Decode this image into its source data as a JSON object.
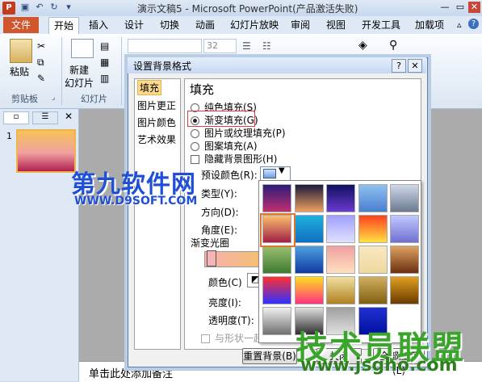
{
  "window": {
    "title": "演示文稿5 - Microsoft PowerPoint(产品激活失败)"
  },
  "tabs": {
    "file": "文件",
    "items": [
      "开始",
      "插入",
      "设计",
      "切换",
      "动画",
      "幻灯片放映",
      "审阅",
      "视图",
      "开发工具",
      "加载项"
    ]
  },
  "ribbon": {
    "paste": "粘贴",
    "clipboard_group": "剪贴板",
    "new_slide": "新建",
    "new_slide2": "幻灯片",
    "slides_group": "幻灯片",
    "font_size": "32"
  },
  "dialog": {
    "title": "设置背景格式",
    "nav": [
      "填充",
      "图片更正",
      "图片颜色",
      "艺术效果"
    ],
    "section_title": "填充",
    "options": [
      "纯色填充(S)",
      "渐变填充(G)",
      "图片或纹理填充(P)",
      "图案填充(A)"
    ],
    "hide_bg": "隐藏背景图形(H)",
    "labels": {
      "preset": "预设颜色(R):",
      "type": "类型(Y):",
      "direction": "方向(D):",
      "angle": "角度(E):",
      "stops": "渐变光圈",
      "color": "颜色(C)",
      "brightness": "亮度(I):",
      "transparency": "透明度(T):",
      "rotate_with_shape": "与形状一起旋转"
    },
    "buttons": {
      "reset": "重置背景(B)",
      "close": "关闭",
      "apply_all": "全部应用(L)"
    }
  },
  "notes": {
    "placeholder": "单击此处添加备注"
  },
  "thumbnail": {
    "number": "1"
  },
  "watermarks": {
    "site1": "第九软件网",
    "site1_url": "WWW.D9SOFT.COM",
    "site2": "技术员联盟",
    "site2_url": "www.jsgho.com"
  },
  "gallery_colors": [
    [
      "#2b1c7a",
      "#c03070"
    ],
    [
      "#1a1a3a",
      "#f0a060"
    ],
    [
      "#101060",
      "#6a3bd0"
    ],
    [
      "#8fc0f0",
      "#4a7fd0"
    ],
    [
      "#cfd8e8",
      "#6a7a90"
    ],
    [
      "#fbbf6a",
      "#a0204a"
    ],
    [
      "#1fb0e0",
      "#0f70c0"
    ],
    [
      "#a0a0ff",
      "#e0e0ff"
    ],
    [
      "#ff4020",
      "#ffe040"
    ],
    [
      "#c0c8ff",
      "#7070d0"
    ],
    [
      "#9ac070",
      "#3e7a30"
    ],
    [
      "#4fa0e0",
      "#0f3aa0"
    ],
    [
      "#f0a0a0",
      "#ffe0c0"
    ],
    [
      "#f8e8c0",
      "#f0d8a0"
    ],
    [
      "#e0a060",
      "#6a3010"
    ],
    [
      "#ff3030",
      "#3030ff"
    ],
    [
      "#ffe020",
      "#ff3080"
    ],
    [
      "#f0e0a0",
      "#b08020"
    ],
    [
      "#d0b060",
      "#806010"
    ],
    [
      "#e0a020",
      "#6a3a00"
    ],
    [
      "#f0f0f0",
      "#707070"
    ],
    [
      "#e0e0e0",
      "#303030"
    ],
    [
      "#a0a0a0",
      "#e0e0e0"
    ],
    [
      "#2030d0",
      "#0010a0"
    ]
  ]
}
